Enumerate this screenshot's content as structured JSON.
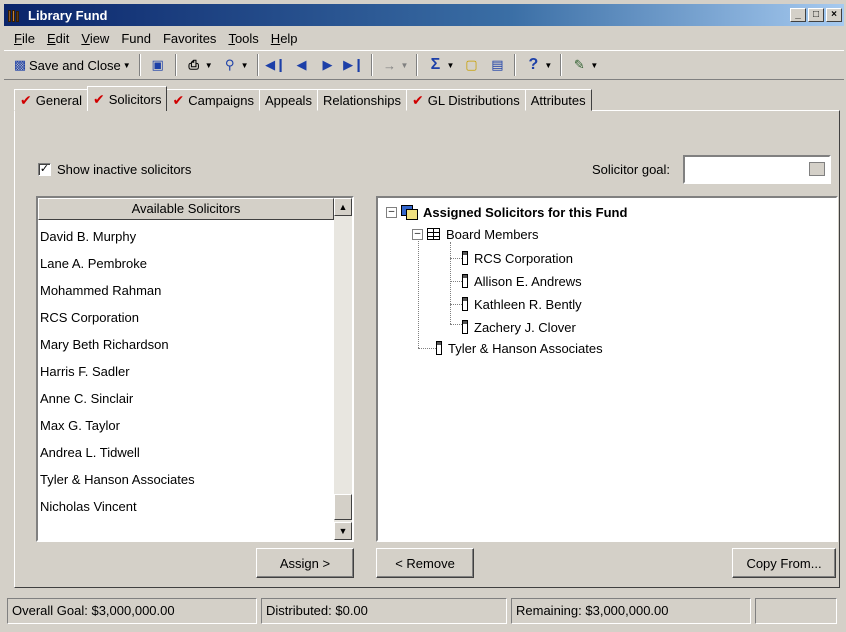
{
  "window": {
    "title": "Library Fund",
    "controls": [
      "_",
      "□",
      "×"
    ]
  },
  "menu": [
    {
      "label": "File",
      "u": "F",
      "rest": "ile"
    },
    {
      "label": "Edit",
      "u": "E",
      "rest": "dit"
    },
    {
      "label": "View",
      "u": "V",
      "rest": "iew"
    },
    {
      "label": "Fund",
      "u": "",
      "rest": "Fund"
    },
    {
      "label": "Favorites",
      "u": "",
      "rest": "Favorites"
    },
    {
      "label": "Tools",
      "u": "T",
      "rest": "ools"
    },
    {
      "label": "Help",
      "u": "H",
      "rest": "elp"
    }
  ],
  "toolbar": {
    "save_close": "Save and Close"
  },
  "tabs": [
    {
      "label": "General",
      "checked": true,
      "active": false
    },
    {
      "label": "Solicitors",
      "checked": true,
      "active": true
    },
    {
      "label": "Campaigns",
      "checked": true,
      "active": false
    },
    {
      "label": "Appeals",
      "checked": false,
      "active": false
    },
    {
      "label": "Relationships",
      "checked": false,
      "active": false
    },
    {
      "label": "GL Distributions",
      "checked": true,
      "active": false
    },
    {
      "label": "Attributes",
      "checked": false,
      "active": false
    }
  ],
  "show_inactive": {
    "label": "Show inactive solicitors",
    "checked": true
  },
  "solicitor_goal": {
    "label": "Solicitor goal:",
    "value": ""
  },
  "available": {
    "header": "Available Solicitors",
    "items": [
      "David B. Murphy",
      "Lane A. Pembroke",
      "Mohammed Rahman",
      "RCS Corporation",
      "Mary Beth Richardson",
      "Harris F. Sadler",
      "Anne C. Sinclair",
      "Max G. Taylor",
      "Andrea L. Tidwell",
      "Tyler & Hanson Associates",
      "Nicholas Vincent"
    ]
  },
  "assigned": {
    "root": "Assigned Solicitors for this Fund",
    "group": "Board Members",
    "group_members": [
      "RCS Corporation",
      "Allison E. Andrews",
      "Kathleen R. Bently",
      "Zachery J. Clover"
    ],
    "other": "Tyler & Hanson Associates"
  },
  "buttons": {
    "assign": "Assign >",
    "remove": "< Remove",
    "copy_from": "Copy From..."
  },
  "status": {
    "overall_goal": "Overall Goal: $3,000,000.00",
    "distributed": "Distributed: $0.00",
    "remaining": "Remaining: $3,000,000.00"
  }
}
